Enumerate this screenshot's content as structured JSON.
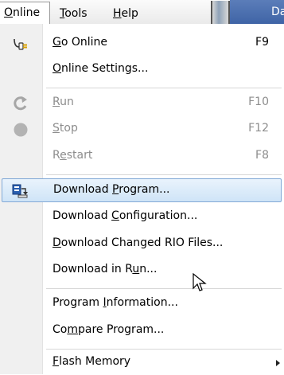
{
  "menubar": {
    "online": {
      "u": "O",
      "rest": "nline"
    },
    "tools": {
      "u": "T",
      "rest": "ools"
    },
    "help": {
      "u": "H",
      "rest": "elp"
    },
    "clipped_title": "Da"
  },
  "menu": {
    "go_online": {
      "u": "G",
      "rest": "o Online",
      "shortcut": "F9"
    },
    "online_settings": {
      "u": "O",
      "rest": "nline Settings..."
    },
    "run": {
      "u": "R",
      "rest": "un",
      "shortcut": "F10"
    },
    "stop": {
      "u": "S",
      "rest": "top",
      "shortcut": "F12"
    },
    "restart": {
      "pre": "R",
      "u": "e",
      "rest": "start",
      "shortcut": "F8"
    },
    "download_program": {
      "pre": "Download ",
      "u": "P",
      "rest": "rogram..."
    },
    "download_configuration": {
      "pre": "Download ",
      "u": "C",
      "rest": "onfiguration..."
    },
    "download_changed_rio": {
      "u": "D",
      "rest": "ownload Changed RIO Files..."
    },
    "download_in_run": {
      "pre": "Download in R",
      "u": "u",
      "rest": "n..."
    },
    "program_information": {
      "pre": "Program ",
      "u": "I",
      "rest": "nformation..."
    },
    "compare_program": {
      "pre": "Co",
      "u": "m",
      "rest": "pare Program..."
    },
    "flash_memory": {
      "u": "F",
      "rest": "lash Memory"
    }
  },
  "icons": {
    "go_online": "connect-plug-icon",
    "run": "run-refresh-icon",
    "stop": "stop-circle-icon",
    "download_program": "download-program-icon",
    "submenu": "chevron-right-icon",
    "cursor": "mouse-pointer-icon"
  },
  "colors": {
    "highlight_fill": "#d7e9fa",
    "highlight_border": "#82a9d6",
    "disabled_text": "#8d8d8d",
    "titlebar_blue": "#4a6fb0"
  }
}
